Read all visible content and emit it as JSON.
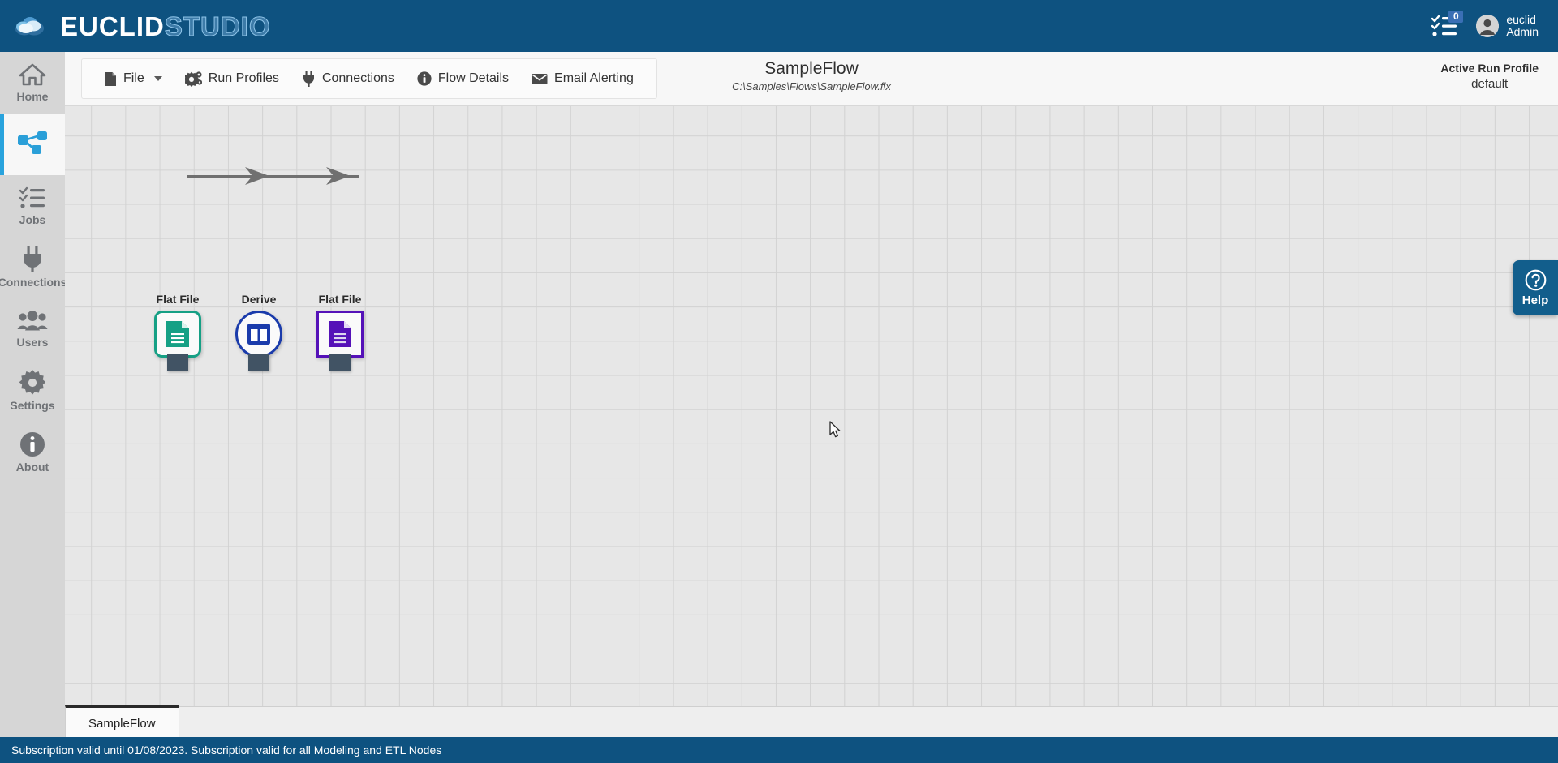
{
  "topbar": {
    "brand_primary": "EUCLID",
    "brand_secondary": "STUDIO",
    "logo_icon": "cloud-icon",
    "tasks_icon": "tasks-checklist-icon",
    "tasks_badge_count": "0",
    "avatar_icon": "user-avatar-icon",
    "user_name": "euclid",
    "user_role": "Admin",
    "background_color": "#0e5280"
  },
  "sidebar": {
    "items": [
      {
        "label": "Home",
        "icon": "home-icon",
        "name": "sidebar-item-home",
        "active": false
      },
      {
        "label": "",
        "icon": "flow-nodes-icon",
        "name": "sidebar-item-flows",
        "active": true
      },
      {
        "label": "Jobs",
        "icon": "jobs-checklist-icon",
        "name": "sidebar-item-jobs",
        "active": false
      },
      {
        "label": "Connections",
        "icon": "plug-icon",
        "name": "sidebar-item-connections",
        "active": false
      },
      {
        "label": "Users",
        "icon": "users-icon",
        "name": "sidebar-item-users",
        "active": false
      },
      {
        "label": "Settings",
        "icon": "gear-icon",
        "name": "sidebar-item-settings",
        "active": false
      },
      {
        "label": "About",
        "icon": "info-icon",
        "name": "sidebar-item-about",
        "active": false
      }
    ],
    "active_accent_color": "#29a3dd"
  },
  "toolbar": {
    "items": [
      {
        "label": "File",
        "icon": "file-icon",
        "name": "menu-item-file",
        "has_chevron": true
      },
      {
        "label": "Run Profiles",
        "icon": "gears-icon",
        "name": "menu-item-run-profiles",
        "has_chevron": false
      },
      {
        "label": "Connections",
        "icon": "plug-icon",
        "name": "menu-item-connections",
        "has_chevron": false
      },
      {
        "label": "Flow Details",
        "icon": "info-circle-icon",
        "name": "menu-item-flow-details",
        "has_chevron": false
      },
      {
        "label": "Email Alerting",
        "icon": "envelope-icon",
        "name": "menu-item-email-alerting",
        "has_chevron": false
      }
    ]
  },
  "flow_header": {
    "title": "SampleFlow",
    "path": "C:\\Samples\\Flows\\SampleFlow.flx",
    "run_profile_title": "Active Run Profile",
    "run_profile_value": "default"
  },
  "canvas": {
    "background_color": "#e7e7e7",
    "grid_line_color": "#d2d2d2",
    "connector_color": "#707070",
    "port_color": "#415364",
    "nodes": [
      {
        "label": "Flat File",
        "icon": "document-icon",
        "shape": "rounded",
        "accent_color": "#16a085",
        "name": "flow-node-flat-file-source"
      },
      {
        "label": "Derive",
        "icon": "table-split-icon",
        "shape": "circle",
        "accent_color": "#1a3bab",
        "name": "flow-node-derive"
      },
      {
        "label": "Flat File",
        "icon": "document-icon",
        "shape": "square",
        "accent_color": "#5512b8",
        "name": "flow-node-flat-file-target"
      }
    ]
  },
  "help": {
    "label": "Help",
    "icon": "question-circle-icon",
    "background_color": "#125e8c"
  },
  "tabstrip": {
    "tabs": [
      {
        "label": "SampleFlow",
        "name": "flow-tab-sampleflow",
        "active": true
      }
    ]
  },
  "statusbar": {
    "text": "Subscription valid until 01/08/2023.   Subscription valid for all Modeling and ETL Nodes",
    "background_color": "#0e5280"
  }
}
